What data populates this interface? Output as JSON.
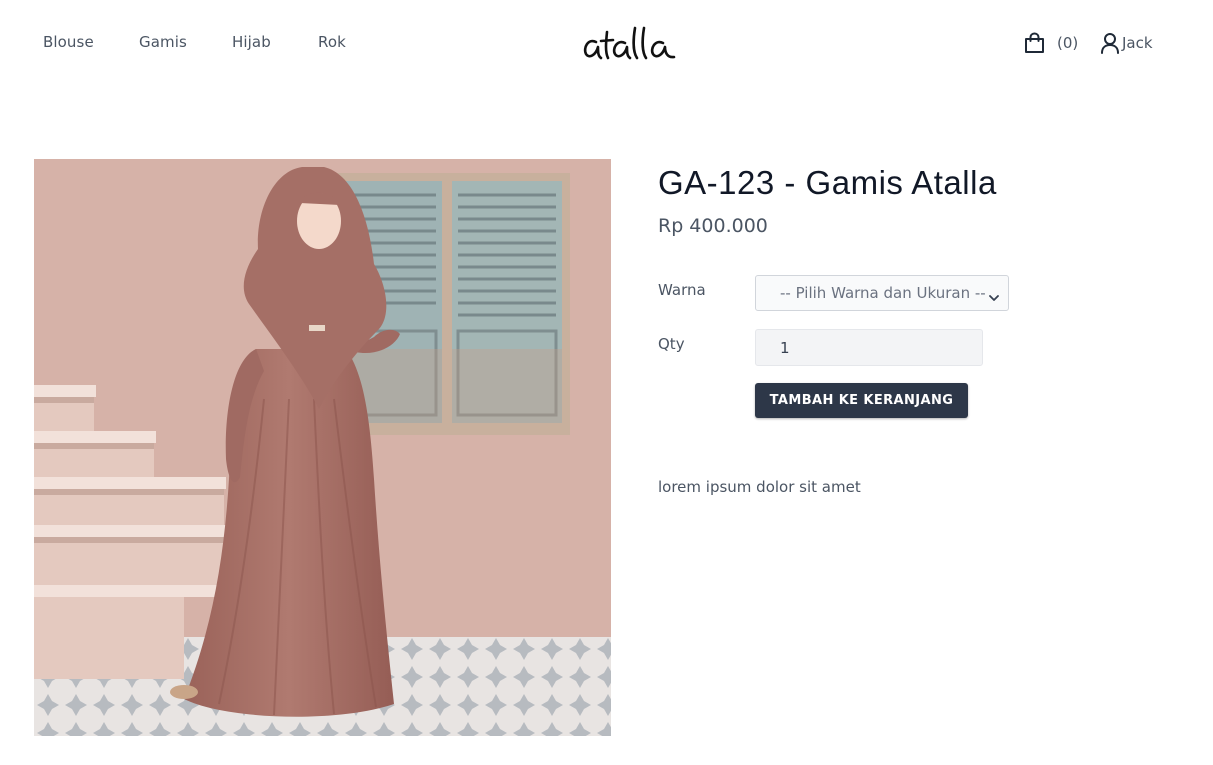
{
  "nav": {
    "links": [
      "Blouse",
      "Gamis",
      "Hijab",
      "Rok"
    ],
    "logo_text": "atalla",
    "cart_icon": "shopping-bag-icon",
    "cart_count": "(0)",
    "user_icon": "user-icon",
    "user_name": "Jack"
  },
  "product": {
    "title": "GA-123 - Gamis Atalla",
    "price": "Rp 400.000",
    "color_label": "Warna",
    "color_select_value": "-- Pilih Warna dan Ukuran --",
    "qty_label": "Qty",
    "qty_value": "1",
    "add_to_cart_label": "TAMBAH KE KERANJANG",
    "description": "lorem ipsum dolor sit amet"
  },
  "colors": {
    "button_bg": "#2d3748",
    "dress": "#a8726a",
    "wall": "#d8b6ab"
  }
}
